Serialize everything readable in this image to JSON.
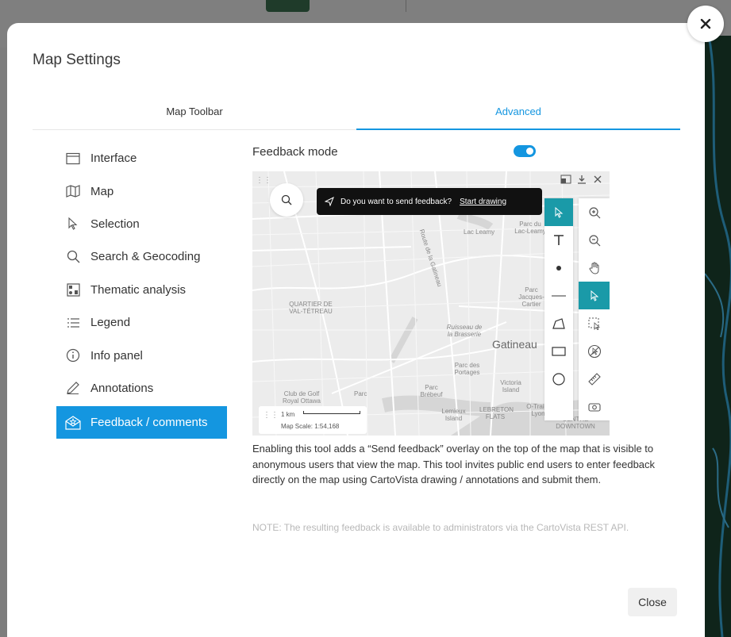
{
  "modal": {
    "title": "Map Settings"
  },
  "tabs": [
    {
      "label": "Map Toolbar",
      "active": false
    },
    {
      "label": "Advanced",
      "active": true
    }
  ],
  "sidebar": {
    "items": [
      {
        "label": "Interface",
        "icon": "window-icon"
      },
      {
        "label": "Map",
        "icon": "map-icon"
      },
      {
        "label": "Selection",
        "icon": "cursor-icon"
      },
      {
        "label": "Search & Geocoding",
        "icon": "search-icon"
      },
      {
        "label": "Thematic analysis",
        "icon": "thematic-icon"
      },
      {
        "label": "Legend",
        "icon": "list-icon"
      },
      {
        "label": "Info panel",
        "icon": "info-icon"
      },
      {
        "label": "Annotations",
        "icon": "pencil-icon"
      },
      {
        "label": "Feedback / comments",
        "icon": "feedback-icon",
        "active": true
      }
    ]
  },
  "content": {
    "feedback_mode_label": "Feedback mode",
    "feedback_mode_on": true,
    "description": "Enabling this tool adds a “Send feedback” overlay on the top of the map that is visible to anonymous users that view the map. This tool invites public end users to enter feedback directly on the map using CartoVista drawing / annotations and submit them.",
    "note": "NOTE: The resulting feedback is available to administrators via the CartoVista REST API."
  },
  "preview": {
    "feedback_prompt": "Do you want to send feedback?",
    "start_drawing": "Start drawing",
    "scale_km": "1 km",
    "scale_text": "Map Scale: 1:54,168",
    "labels": {
      "route": "Route de la Gatineau",
      "lac_leamy": "Lac Leamy",
      "parc_lac_leamy": "Parc du Lac-Leamy",
      "parc_jacques": "Parc Jacques-Cartier",
      "quartier": "QUARTIER DE VAL-TÉTREAU",
      "ruisseau": "Ruisseau de la Brasserie",
      "gatineau": "Gatineau",
      "parc_portages": "Parc des Portages",
      "club_golf": "Club de Golf Royal Ottawa",
      "parc1": "Parc",
      "parc_brebeuf": "Parc Brébeuf",
      "victoria": "Victoria Island",
      "lemieux": "Lemieux Island",
      "lebreton": "LEBRETON FLATS",
      "otrain": "O-Train-Lyon",
      "centre": "CENTRE DOWNTOWN"
    }
  },
  "footer": {
    "close_label": "Close"
  },
  "colors": {
    "accent": "#1496e0",
    "tool_selected": "#1a9aa8"
  }
}
